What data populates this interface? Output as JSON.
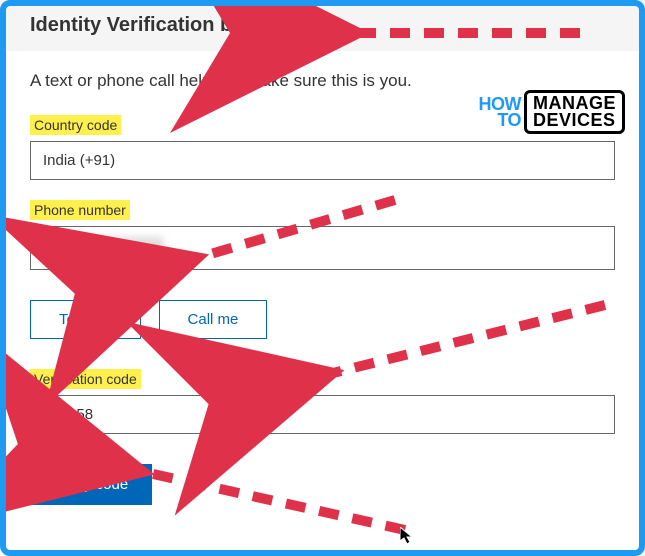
{
  "header": {
    "title": "Identity Verification by phone"
  },
  "subtitle": "A text or phone call helps us make sure this is you.",
  "fields": {
    "country": {
      "label": "Country code",
      "value": "India (+91)"
    },
    "phone": {
      "label": "Phone number",
      "value": ""
    },
    "verification": {
      "label": "Verification code",
      "value": "369058"
    }
  },
  "buttons": {
    "text_me": "Text me",
    "call_me": "Call me",
    "verify": "Verify code"
  },
  "watermark": {
    "how": "HOW",
    "to": "TO",
    "manage": "MANAGE",
    "devices": "DEVICES"
  },
  "annotations": {
    "highlight_color": "#fff04d",
    "arrow_color": "#e0314b",
    "border_color": "#1e9bf0"
  }
}
